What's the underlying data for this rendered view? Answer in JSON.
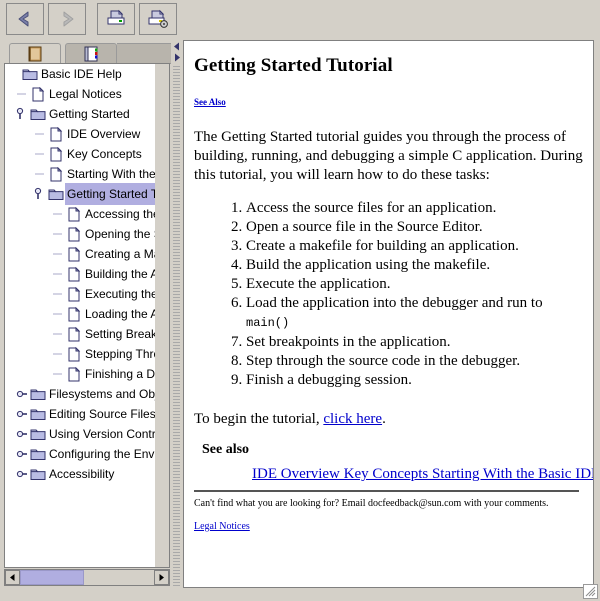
{
  "window": {
    "title": "Basic IDE Help",
    "background_color": "#d4d0c8",
    "border_color": "#808080"
  },
  "toolbar": {
    "buttons": [
      {
        "name": "back-button",
        "icon": "back-arrow-icon",
        "tooltip": "Back",
        "enabled": true
      },
      {
        "name": "forward-button",
        "icon": "forward-arrow-icon",
        "tooltip": "Forward",
        "enabled": false
      },
      {
        "name": "print-button",
        "icon": "printer-icon",
        "tooltip": "Print",
        "enabled": true
      },
      {
        "name": "page-setup-button",
        "icon": "printer-setup-icon",
        "tooltip": "Page Setup",
        "enabled": true
      }
    ]
  },
  "tabs": [
    {
      "name": "tab-contents",
      "icon": "book-icon",
      "label": "",
      "selected": true
    },
    {
      "name": "tab-index",
      "icon": "index-card-icon",
      "label": "",
      "selected": false
    }
  ],
  "tree": {
    "selected_label": "Getting Started Tutorial",
    "selection_color": "#b0aee0",
    "items": [
      {
        "label": "Basic IDE Help",
        "depth": 0,
        "type": "folder-open",
        "handle": "none",
        "selected": false
      },
      {
        "label": "Legal Notices",
        "depth": 1,
        "type": "page",
        "handle": "none",
        "selected": false
      },
      {
        "label": "Getting Started",
        "depth": 1,
        "type": "folder",
        "handle": "expanded",
        "selected": false
      },
      {
        "label": "IDE Overview",
        "depth": 2,
        "type": "page",
        "handle": "none",
        "selected": false
      },
      {
        "label": "Key Concepts",
        "depth": 2,
        "type": "page",
        "handle": "none",
        "selected": false
      },
      {
        "label": "Starting With the Basic IDE",
        "depth": 2,
        "type": "page",
        "handle": "none",
        "selected": false
      },
      {
        "label": "Getting Started Tutorial",
        "depth": 2,
        "type": "folder",
        "handle": "expanded",
        "selected": true
      },
      {
        "label": "Accessing the Source Files",
        "depth": 3,
        "type": "page",
        "handle": "none",
        "selected": false
      },
      {
        "label": "Opening the Source File",
        "depth": 3,
        "type": "page",
        "handle": "none",
        "selected": false
      },
      {
        "label": "Creating a Makefile",
        "depth": 3,
        "type": "page",
        "handle": "none",
        "selected": false
      },
      {
        "label": "Building the Application",
        "depth": 3,
        "type": "page",
        "handle": "none",
        "selected": false
      },
      {
        "label": "Executing the Application",
        "depth": 3,
        "type": "page",
        "handle": "none",
        "selected": false
      },
      {
        "label": "Loading the Application",
        "depth": 3,
        "type": "page",
        "handle": "none",
        "selected": false
      },
      {
        "label": "Setting Breakpoints",
        "depth": 3,
        "type": "page",
        "handle": "none",
        "selected": false
      },
      {
        "label": "Stepping Through the Code",
        "depth": 3,
        "type": "page",
        "handle": "none",
        "selected": false
      },
      {
        "label": "Finishing a Debugging Session",
        "depth": 3,
        "type": "page",
        "handle": "none",
        "selected": false
      },
      {
        "label": "Filesystems and Objects",
        "depth": 1,
        "type": "folder",
        "handle": "collapsed",
        "selected": false
      },
      {
        "label": "Editing Source Files",
        "depth": 1,
        "type": "folder",
        "handle": "collapsed",
        "selected": false
      },
      {
        "label": "Using Version Control in the IDE",
        "depth": 1,
        "type": "folder",
        "handle": "collapsed",
        "selected": false
      },
      {
        "label": "Configuring the Environment",
        "depth": 1,
        "type": "folder",
        "handle": "collapsed",
        "selected": false
      },
      {
        "label": "Accessibility",
        "depth": 1,
        "type": "folder",
        "handle": "collapsed",
        "selected": false
      }
    ]
  },
  "tree_scrollbar": {
    "left_arrow": "◀",
    "right_arrow": "▶",
    "thumb_color": "#b0aee0"
  },
  "splitter": {
    "collapse_left_arrow": "◀",
    "collapse_right_arrow": "▶"
  },
  "content": {
    "title": "Getting Started Tutorial",
    "see_also_top_link": "See Also",
    "intro": "The Getting Started tutorial guides you through the process of building, running, and debugging a simple C application. During this tutorial, you will learn how to do these tasks:",
    "tasks": [
      {
        "text": "Access the source files for an application.",
        "mono": ""
      },
      {
        "text": "Open a source file in the Source Editor.",
        "mono": ""
      },
      {
        "text": "Create a makefile for building an application.",
        "mono": ""
      },
      {
        "text": "Build the application using the makefile.",
        "mono": ""
      },
      {
        "text": "Execute the application.",
        "mono": ""
      },
      {
        "text": "Load the application into the debugger and run to ",
        "mono": "main()"
      },
      {
        "text": "Set breakpoints in the application.",
        "mono": ""
      },
      {
        "text": "Step through the source code in the debugger.",
        "mono": ""
      },
      {
        "text": "Finish a debugging session.",
        "mono": ""
      }
    ],
    "begin_prefix": "To begin the tutorial, ",
    "begin_link": "click here",
    "begin_suffix": ".",
    "see_also_heading": "See also",
    "see_also_links": "IDE Overview Key Concepts Starting With the Basic IDE Tasks Catalog",
    "footnote": "Can't find what you are looking for? Email docfeedback@sun.com with your comments.",
    "legal_link": "Legal Notices",
    "link_color": "#0000cc"
  }
}
